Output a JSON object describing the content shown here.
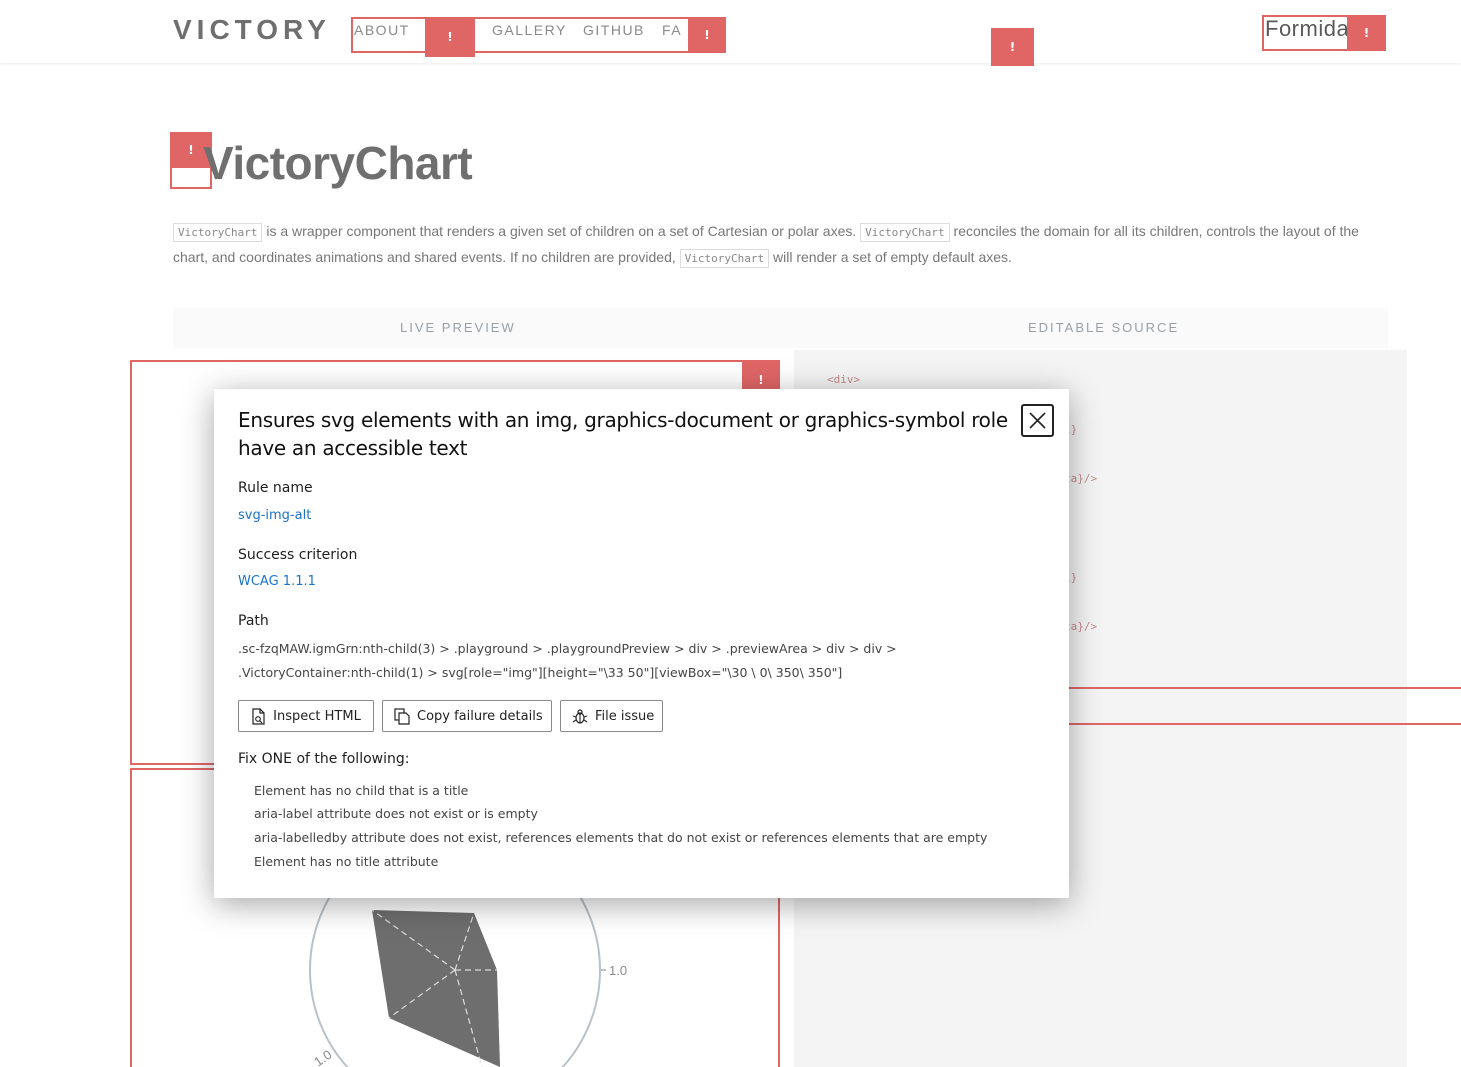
{
  "header": {
    "logo": "VICTORY",
    "nav": [
      "ABOUT",
      "GALLERY",
      "GITHUB",
      "FAQ"
    ],
    "nav_faq_visible": "FA",
    "brand": "Formida"
  },
  "flag_symbol": "!",
  "page": {
    "title": "VictoryChart",
    "intro": {
      "chip": "VictoryChart",
      "part1": " is a wrapper component that renders a given set of children on a set of Cartesian or polar axes. ",
      "part2": " reconciles the domain for all its children, controls the layout of the chart, and coordinates animations and shared events. If no children are provided, ",
      "part3": " will render a set of empty default axes."
    },
    "tabs": {
      "live_preview": "LIVE PREVIEW",
      "editable_source": "EDITABLE SOURCE"
    },
    "source_lines": [
      "<div>",
      "l}",
      "ta}/>",
      "l}",
      "ta}/>"
    ]
  },
  "dialog": {
    "title": "Ensures svg elements with an img, graphics-document or graphics-symbol role have an accessible text",
    "rule_name_label": "Rule name",
    "rule_name": "svg-img-alt",
    "success_label": "Success criterion",
    "success": "WCAG 1.1.1",
    "path_label": "Path",
    "path": ".sc-fzqMAW.igmGrn:nth-child(3) > .playground > .playgroundPreview > div > .previewArea > div > div > .VictoryContainer:nth-child(1) > svg[role=\"img\"][height=\"\\33 50\"][viewBox=\"\\30 \\ 0\\ 350\\ 350\"]",
    "buttons": {
      "inspect": "Inspect HTML",
      "copy": "Copy failure details",
      "file": "File issue"
    },
    "fix_label": "Fix ONE of the following:",
    "fixes": [
      "Element has no child that is a title",
      "aria-label attribute does not exist or is empty",
      "aria-labelledby attribute does not exist, references elements that do not exist or references elements that are empty",
      "Element has no title attribute"
    ]
  },
  "chart_data": {
    "type": "radar",
    "tick_labels": [
      "1.0",
      "1.0"
    ],
    "polygon_fill": "#6e6e6e"
  },
  "colors": {
    "highlight": "#e06666",
    "link": "#1a73c8"
  }
}
